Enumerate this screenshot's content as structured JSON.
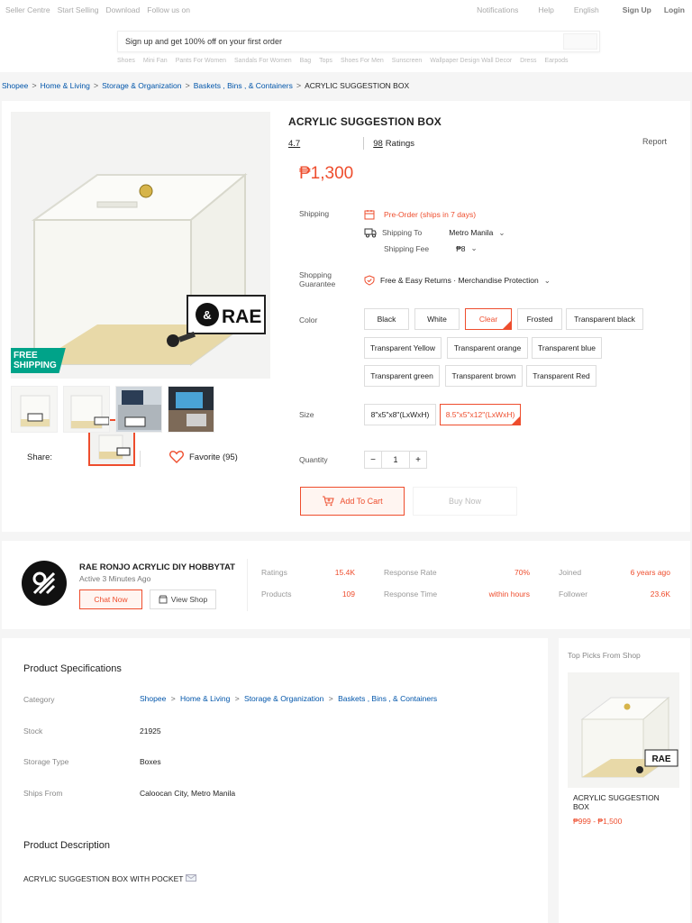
{
  "topbar": {
    "left_links": [
      "Seller Centre",
      "Start Selling",
      "Download",
      "Follow us on"
    ],
    "right_links": [
      "Notifications",
      "Help",
      "English"
    ],
    "signup": "Sign Up",
    "login": "Login"
  },
  "search": {
    "placeholder": "Sign up and get 100% off on your first order",
    "hints": [
      "Shoes",
      "Mini Fan",
      "Pants For Women",
      "Sandals For Women",
      "Bag",
      "Tops",
      "Shoes For Men",
      "Sunscreen",
      "Wallpaper Design Wall Decor",
      "Dress",
      "Earpods"
    ]
  },
  "breadcrumb": [
    "Shopee",
    "Home & Living",
    "Storage & Organization",
    "Baskets , Bins , & Containers"
  ],
  "breadcrumb_current": "ACRYLIC SUGGESTION BOX",
  "product": {
    "free_shipping_line1": "FREE",
    "free_shipping_line2": "SHIPPING",
    "brand_text": "RAE",
    "title": "ACRYLIC SUGGESTION BOX",
    "rating": "4.7",
    "ratings_count": "98",
    "ratings_label": "Ratings",
    "report": "Report",
    "price": "₱1,300",
    "shipping_label": "Shipping",
    "preorder": "Pre-Order (ships in 7 days)",
    "shipping_to_label": "Shipping To",
    "shipping_to": "Metro Manila",
    "shipping_fee_label": "Shipping Fee",
    "shipping_fee": "₱8",
    "guarantee_label_1": "Shopping",
    "guarantee_label_2": "Guarantee",
    "guarantee": "Free & Easy Returns · Merchandise Protection",
    "color_label": "Color",
    "colors": [
      "Black",
      "White",
      "Clear",
      "Frosted",
      "Transparent black",
      "Transparent Yellow",
      "Transparent orange",
      "Transparent blue",
      "Transparent green",
      "Transparent brown",
      "Transparent Red"
    ],
    "size_label": "Size",
    "sizes": [
      "8\"x5\"x8\"(LxWxH)",
      "8.5\"x5\"x12\"(LxWxH)"
    ],
    "quantity_label": "Quantity",
    "quantity": "1",
    "add_to_cart": "Add To Cart",
    "buy_now": "Buy Now",
    "share": "Share:",
    "favorite": "Favorite (95)"
  },
  "shop": {
    "name": "RAE RONJO ACRYLIC DIY HOBBYTAT",
    "active": "Active 3 Minutes Ago",
    "chat": "Chat Now",
    "view_shop": "View Shop",
    "stats": [
      {
        "label": "Ratings",
        "value": "15.4K"
      },
      {
        "label": "Products",
        "value": "109"
      },
      {
        "label": "Response Rate",
        "value": "70%"
      },
      {
        "label": "Response Time",
        "value": "within hours"
      },
      {
        "label": "Joined",
        "value": "6 years ago"
      },
      {
        "label": "Follower",
        "value": "23.6K"
      }
    ]
  },
  "specs": {
    "title": "Product Specifications",
    "category_label": "Category",
    "stock_label": "Stock",
    "stock": "21925",
    "storage_label": "Storage Type",
    "storage": "Boxes",
    "ships_label": "Ships From",
    "ships": "Caloocan City, Metro Manila",
    "desc_title": "Product Description",
    "desc": "ACRYLIC SUGGESTION  BOX WITH POCKET"
  },
  "top_picks": {
    "title": "Top Picks From Shop",
    "name": "ACRYLIC SUGGESTION BOX",
    "price": "₱999 - ₱1,500"
  },
  "colors": {
    "accent": "#ee4d2d",
    "link": "#0055aa",
    "free_shipping": "#00a389"
  }
}
